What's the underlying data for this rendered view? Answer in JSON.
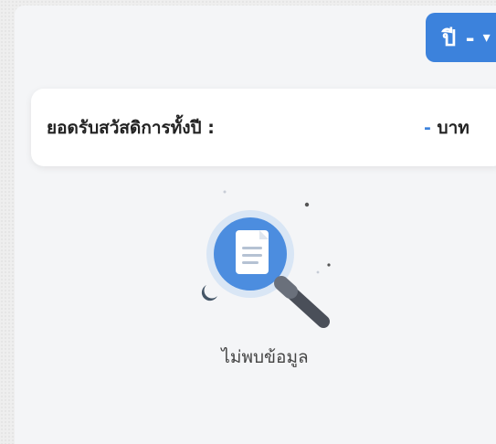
{
  "filter": {
    "year_label": "ปี -",
    "chevron_icon": "chevron-down-icon"
  },
  "summary": {
    "title": "ยอดรับสวัสดิการทั้งปี :",
    "amount": "-",
    "unit": "บาท"
  },
  "empty_state": {
    "message": "ไม่พบข้อมูล",
    "icon": "magnifier-document-icon"
  },
  "colors": {
    "accent": "#3c82dc",
    "panel": "#f4f5f7",
    "card": "#ffffff",
    "text": "#222222"
  }
}
